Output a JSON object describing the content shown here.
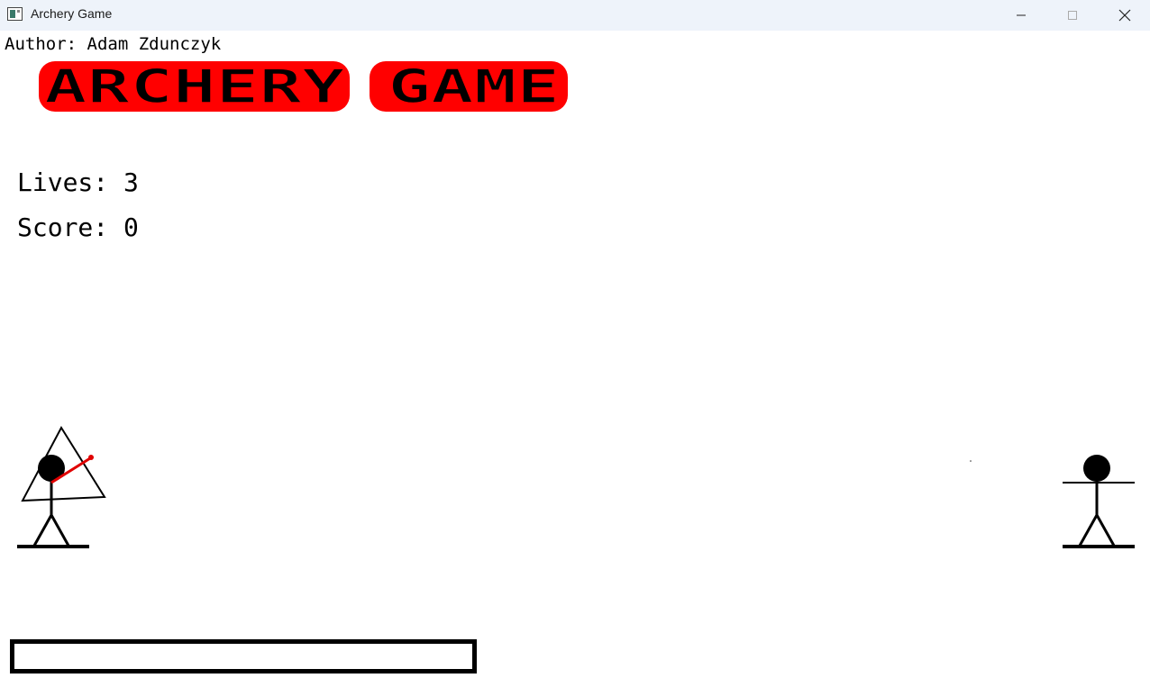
{
  "window": {
    "title": "Archery Game"
  },
  "game": {
    "author_text": "Author: Adam Zdunczyk",
    "logo_text": "ARCHERY GAME",
    "lives_text": "Lives: 3",
    "score_text": "Score: 0",
    "lives": 3,
    "score": 0,
    "power_fraction": 0,
    "arrow_color": "#e00000",
    "logo_fill": "#ff0000",
    "logo_text_color": "#000000"
  }
}
